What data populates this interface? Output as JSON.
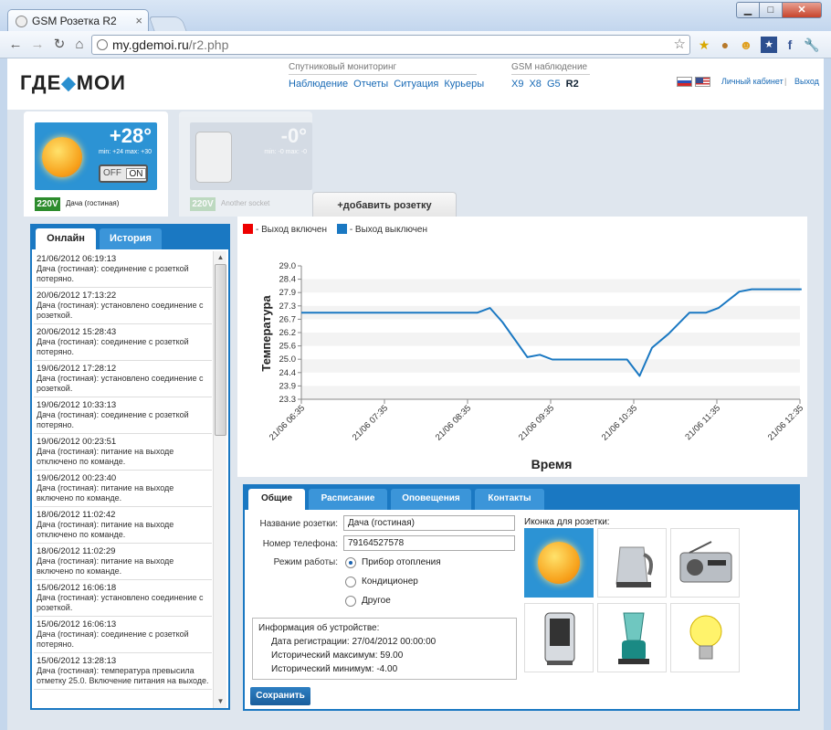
{
  "browser": {
    "tab_title": "GSM Розетка R2",
    "url_domain": "my.gdemoi.ru",
    "url_path": "/r2.php"
  },
  "header": {
    "logo_left": "ГДЕ",
    "logo_right": "МОИ",
    "sat_group_title": "Спутниковый мониторинг",
    "sat_links": [
      "Наблюдение",
      "Отчеты",
      "Ситуация",
      "Курьеры"
    ],
    "gsm_group_title": "GSM наблюдение",
    "gsm_links": [
      "X9",
      "X8",
      "G5",
      "R2"
    ],
    "account_link": "Личный кабинет",
    "separator": "|",
    "logout_link": "Выход"
  },
  "sockets": [
    {
      "temp": "+28°",
      "minmax": "min: +24 max: +30",
      "off": "OFF",
      "on": "ON",
      "voltage": "220V",
      "name": "Дача (гостиная)"
    },
    {
      "temp": "-0°",
      "minmax": "min: -0 max: -0",
      "voltage": "220V",
      "name": "Another socket"
    }
  ],
  "add_socket_label": "+добавить розетку",
  "log": {
    "tabs": [
      "Онлайн",
      "История"
    ],
    "entries": [
      {
        "date": "21/06/2012 06:19:13",
        "text": "Дача (гостиная): соединение с розеткой потеряно."
      },
      {
        "date": "20/06/2012 17:13:22",
        "text": "Дача (гостиная): установлено соединение с розеткой."
      },
      {
        "date": "20/06/2012 15:28:43",
        "text": "Дача (гостиная): соединение с розеткой потеряно."
      },
      {
        "date": "19/06/2012 17:28:12",
        "text": "Дача (гостиная): установлено соединение с розеткой."
      },
      {
        "date": "19/06/2012 10:33:13",
        "text": "Дача (гостиная): соединение с розеткой потеряно."
      },
      {
        "date": "19/06/2012 00:23:51",
        "text": "Дача (гостиная): питание на выходе отключено по команде."
      },
      {
        "date": "19/06/2012 00:23:40",
        "text": "Дача (гостиная): питание на выходе включено по команде."
      },
      {
        "date": "18/06/2012 11:02:42",
        "text": "Дача (гостиная): питание на выходе отключено по команде."
      },
      {
        "date": "18/06/2012 11:02:29",
        "text": "Дача (гостиная): питание на выходе включено по команде."
      },
      {
        "date": "15/06/2012 16:06:18",
        "text": "Дача (гостиная): установлено соединение с розеткой."
      },
      {
        "date": "15/06/2012 16:06:13",
        "text": "Дача (гостиная): соединение с розеткой потеряно."
      },
      {
        "date": "15/06/2012 13:28:13",
        "text": "Дача (гостиная): температура превысила отметку 25.0. Включение питания на выходе."
      }
    ]
  },
  "chart_data": {
    "type": "line",
    "legend": [
      {
        "label": "- Выход включен",
        "color": "#ee0000"
      },
      {
        "label": "- Выход выключен",
        "color": "#1a78c2"
      }
    ],
    "xlabel": "Время",
    "ylabel": "Температура",
    "yticks": [
      "29.0",
      "28.4",
      "27.9",
      "27.3",
      "26.7",
      "26.2",
      "25.6",
      "25.0",
      "24.4",
      "23.9",
      "23.3"
    ],
    "ylim": [
      23.3,
      29.0
    ],
    "xticks": [
      "21/06 06:35",
      "21/06 07:35",
      "21/06 08:35",
      "21/06 09:35",
      "21/06 10:35",
      "21/06 11:35",
      "21/06 12:35"
    ],
    "series": [
      {
        "color": "#1a78c2",
        "x": [
          6.58,
          7.0,
          7.5,
          8.0,
          8.5,
          8.7,
          8.85,
          9.0,
          9.3,
          9.45,
          9.6,
          10.0,
          10.3,
          10.5,
          10.65,
          10.8,
          11.0,
          11.25,
          11.45,
          11.6,
          11.85,
          12.0,
          12.3,
          12.6
        ],
        "y": [
          27.0,
          27.0,
          27.0,
          27.0,
          27.0,
          27.0,
          27.2,
          26.6,
          25.1,
          25.2,
          25.0,
          25.0,
          25.0,
          25.0,
          24.3,
          25.5,
          26.1,
          27.0,
          27.0,
          27.2,
          27.9,
          28.0,
          28.0,
          28.0
        ]
      }
    ]
  },
  "settings": {
    "tabs": [
      "Общие",
      "Расписание",
      "Оповещения",
      "Контакты"
    ],
    "name_label": "Название розетки:",
    "name_value": "Дача (гостиная)",
    "phone_label": "Номер телефона:",
    "phone_value": "79164527578",
    "mode_label": "Режим работы:",
    "modes": [
      "Прибор отопления",
      "Кондиционер",
      "Другое"
    ],
    "info_title": "Информация об устройстве:",
    "info_lines": [
      "Дата регистрации: 27/04/2012 00:00:00",
      "Исторический максимум: 59.00",
      "Исторический минимум: -4.00"
    ],
    "icons_label": "Иконка для розетки:",
    "icons": [
      "sun-icon",
      "kettle-icon",
      "radio-icon",
      "heater-icon",
      "blender-icon",
      "lightbulb-icon"
    ],
    "save_label": "Сохранить"
  }
}
